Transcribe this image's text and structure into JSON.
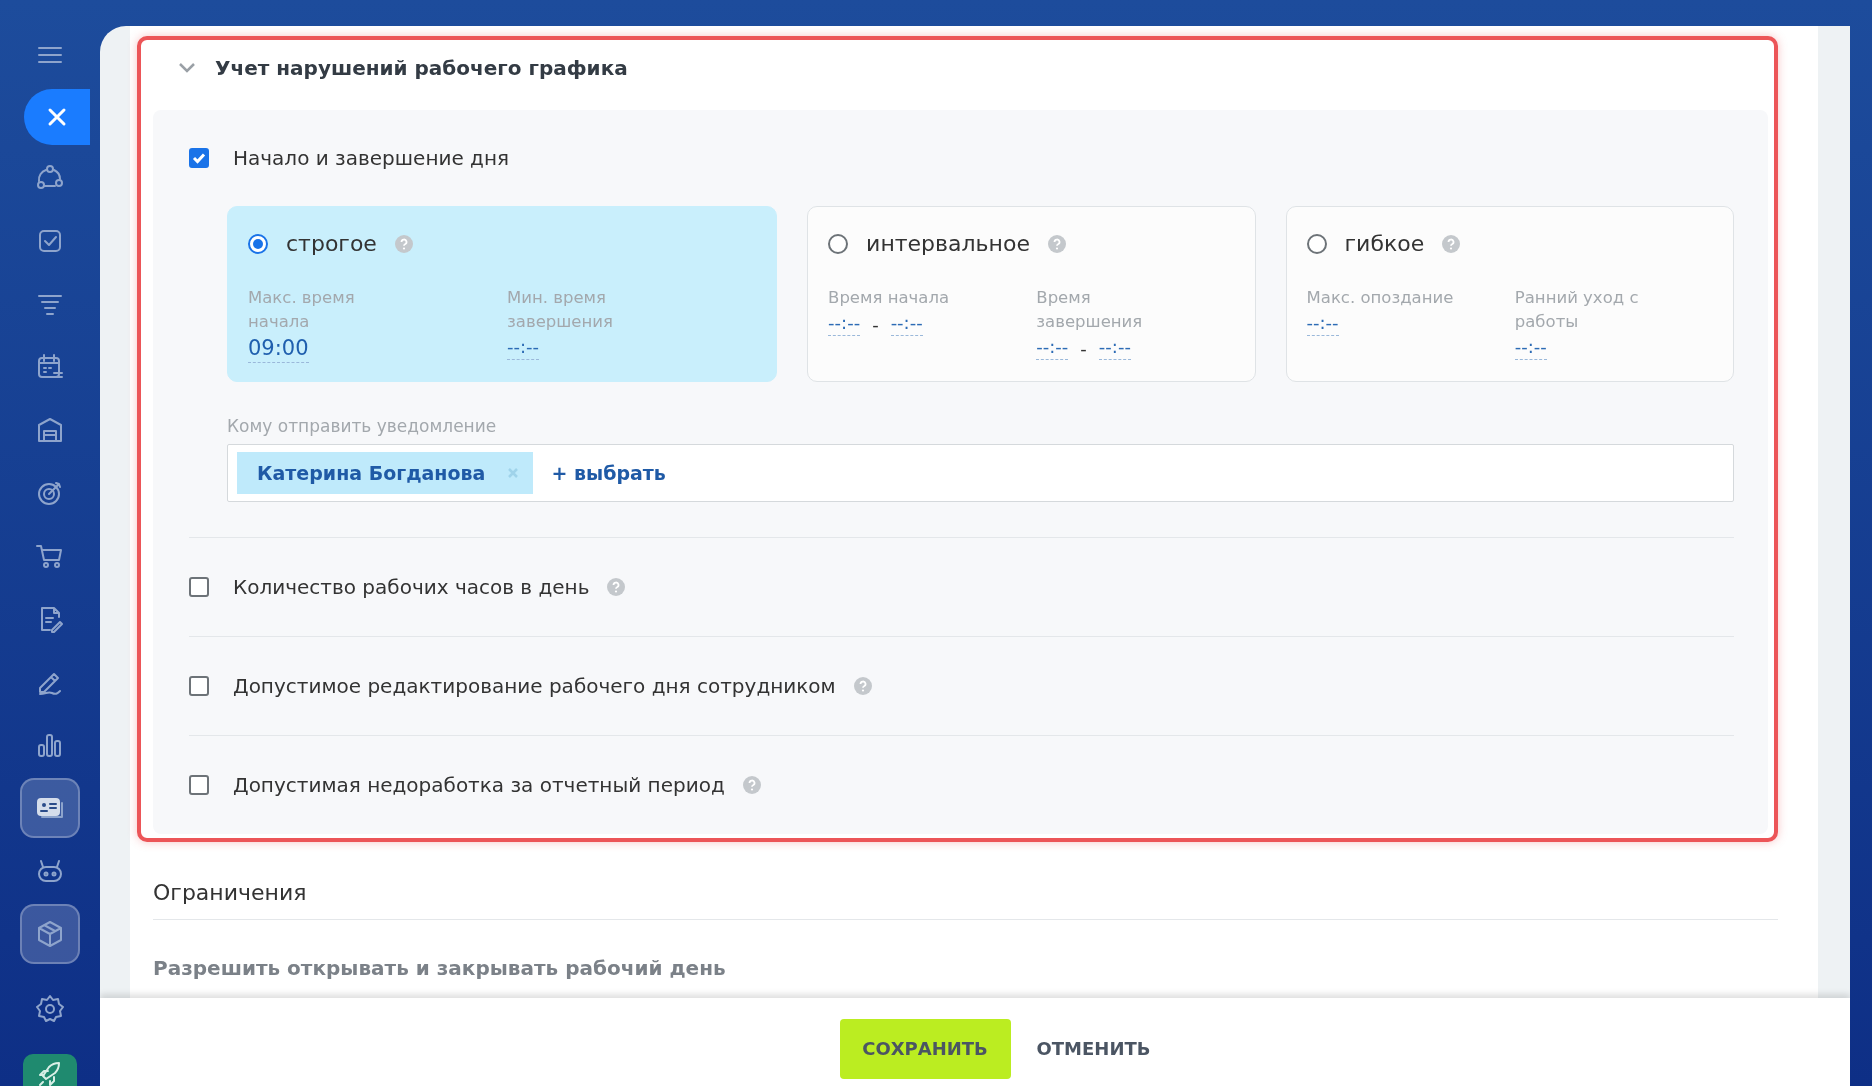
{
  "sidebar": {
    "items": [
      {
        "kind": "menu",
        "selected": false
      },
      {
        "kind": "close",
        "selected": false
      },
      {
        "kind": "flow",
        "selected": false
      },
      {
        "kind": "task",
        "selected": false
      },
      {
        "kind": "funnel",
        "selected": false
      },
      {
        "kind": "calendar",
        "selected": false
      },
      {
        "kind": "warehouse",
        "selected": false
      },
      {
        "kind": "target",
        "selected": false
      },
      {
        "kind": "cart",
        "selected": false
      },
      {
        "kind": "document",
        "selected": false
      },
      {
        "kind": "pen",
        "selected": false
      },
      {
        "kind": "chart",
        "selected": false
      },
      {
        "kind": "card",
        "selected": true
      },
      {
        "kind": "robot",
        "selected": false
      },
      {
        "kind": "cube",
        "selected": true
      },
      {
        "kind": "settings",
        "selected": false
      },
      {
        "kind": "rocket",
        "selected": false
      }
    ]
  },
  "section": {
    "title": "Учет нарушений рабочего графика",
    "expanded": true
  },
  "day_rule": {
    "label": "Начало и завершение дня",
    "checked": true
  },
  "modes": [
    {
      "label": "строгое",
      "selected": true,
      "fields": [
        {
          "label": "Макс. время начала",
          "values": [
            "09:00"
          ]
        },
        {
          "label": "Мин. время завершения",
          "values": [
            "--:--"
          ]
        }
      ]
    },
    {
      "label": "интервальное",
      "selected": false,
      "fields": [
        {
          "label": "Время начала",
          "values": [
            "--:--",
            "--:--"
          ],
          "separator": "-"
        },
        {
          "label": "Время завершения",
          "values": [
            "--:--",
            "--:--"
          ],
          "separator": "-"
        }
      ]
    },
    {
      "label": "гибкое",
      "selected": false,
      "fields": [
        {
          "label": "Макс. опоздание",
          "values": [
            "--:--"
          ]
        },
        {
          "label": "Ранний уход с работы",
          "values": [
            "--:--"
          ]
        }
      ]
    }
  ],
  "notify": {
    "label": "Кому отправить уведомление",
    "recipients": [
      {
        "name": "Катерина Богданова"
      }
    ],
    "add": "+ выбрать"
  },
  "options": [
    {
      "label": "Количество рабочих часов в день",
      "checked": false
    },
    {
      "label": "Допустимое редактирование рабочего дня сотрудником",
      "checked": false
    },
    {
      "label": "Допустимая недоработка за отчетный период",
      "checked": false
    }
  ],
  "limits": {
    "title": "Ограничения",
    "first_option": "Разрешить открывать и закрывать рабочий день"
  },
  "footer": {
    "buttons": [
      {
        "label": "СОХРАНИТЬ",
        "kind": "primary"
      },
      {
        "label": "ОТМЕНИТЬ",
        "kind": "link"
      }
    ]
  }
}
